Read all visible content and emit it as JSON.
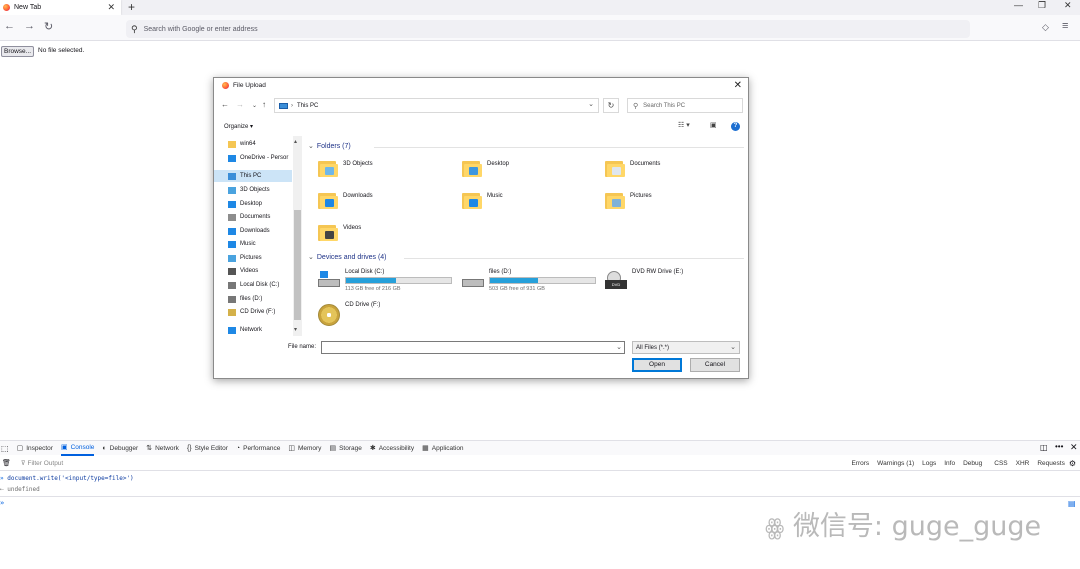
{
  "browser": {
    "tab_title": "New Tab",
    "tab_close": "✕",
    "new_tab": "+",
    "address_placeholder": "Search with Google or enter address",
    "nav_back": "←",
    "nav_forward": "→",
    "nav_reload": "↻",
    "win_minimize": "—",
    "win_restore": "❐",
    "win_close": "✕",
    "pocket": "◇",
    "menu": "≡"
  },
  "page": {
    "browse_label": "Browse...",
    "no_file_text": "No file selected."
  },
  "dialog": {
    "title": "File Upload",
    "address": "This PC",
    "search_placeholder": "Search This PC",
    "organize": "Organize ▾",
    "sidebar": [
      {
        "label": "win64",
        "icon": "folder-icon",
        "color": "#f5c653"
      },
      {
        "label": "OneDrive - Persor",
        "icon": "cloud-icon",
        "color": "#1e88e5"
      },
      {
        "label": "This PC",
        "icon": "pc-icon",
        "color": "#3b8ed8"
      },
      {
        "label": "3D Objects",
        "icon": "3d-objects-icon",
        "color": "#4aa3df"
      },
      {
        "label": "Desktop",
        "icon": "desktop-icon",
        "color": "#1e88e5"
      },
      {
        "label": "Documents",
        "icon": "documents-icon",
        "color": "#8d8d8d"
      },
      {
        "label": "Downloads",
        "icon": "downloads-icon",
        "color": "#1e88e5"
      },
      {
        "label": "Music",
        "icon": "music-icon",
        "color": "#1e88e5"
      },
      {
        "label": "Pictures",
        "icon": "pictures-icon",
        "color": "#4aa3df"
      },
      {
        "label": "Videos",
        "icon": "videos-icon",
        "color": "#555555"
      },
      {
        "label": "Local Disk (C:)",
        "icon": "disk-icon",
        "color": "#777777"
      },
      {
        "label": "files (D:)",
        "icon": "disk-icon",
        "color": "#777777"
      },
      {
        "label": "CD Drive (F:)",
        "icon": "cd-icon",
        "color": "#d4b14a"
      },
      {
        "label": "Network",
        "icon": "network-icon",
        "color": "#1e88e5"
      }
    ],
    "folders_header": "Folders (7)",
    "folders": [
      {
        "label": "3D Objects",
        "badge": "#6fb7e9"
      },
      {
        "label": "Desktop",
        "badge": "#3d97e0"
      },
      {
        "label": "Documents",
        "badge": "#dfe6ee"
      },
      {
        "label": "Downloads",
        "badge": "#1e88e5"
      },
      {
        "label": "Music",
        "badge": "#1e88e5"
      },
      {
        "label": "Pictures",
        "badge": "#7fb2d8"
      },
      {
        "label": "Videos",
        "badge": "#444444"
      }
    ],
    "drives_header": "Devices and drives (4)",
    "drives": [
      {
        "label": "Local Disk (C:)",
        "free": "113 GB free of 216 GB",
        "used_fraction": 0.48
      },
      {
        "label": "files (D:)",
        "free": "503 GB free of 931 GB",
        "used_fraction": 0.46
      },
      {
        "label": "DVD RW Drive (E:)",
        "free": "",
        "used_fraction": null
      },
      {
        "label": "CD Drive (F:)",
        "free": "",
        "used_fraction": null
      }
    ],
    "filename_label": "File name:",
    "filename_value": "",
    "filter": "All Files (*.*)",
    "open": "Open",
    "cancel": "Cancel"
  },
  "devtools": {
    "tabs": [
      {
        "label": "Inspector",
        "icon": "▢"
      },
      {
        "label": "Console",
        "icon": "▣"
      },
      {
        "label": "Debugger",
        "icon": "◐"
      },
      {
        "label": "Network",
        "icon": "⇅"
      },
      {
        "label": "Style Editor",
        "icon": "{}"
      },
      {
        "label": "Performance",
        "icon": "◔"
      },
      {
        "label": "Memory",
        "icon": "◫"
      },
      {
        "label": "Storage",
        "icon": "▤"
      },
      {
        "label": "Accessibility",
        "icon": "✱"
      },
      {
        "label": "Application",
        "icon": "▦"
      }
    ],
    "filter_placeholder": "Filter Output",
    "filters": [
      "Errors",
      "Warnings (1)",
      "Logs",
      "Info",
      "Debug",
      "CSS",
      "XHR",
      "Requests"
    ],
    "console_input": "document.write('<input/type=file>')",
    "console_output": "undefined"
  },
  "watermark": "微信号: guge_guge"
}
